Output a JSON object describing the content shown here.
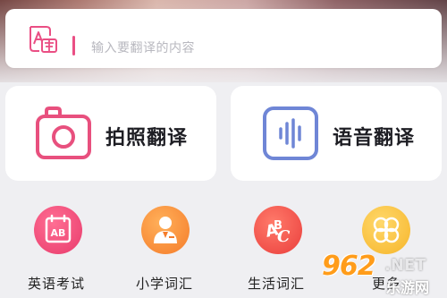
{
  "search": {
    "placeholder": "输入要翻译的内容",
    "icon": "translate-icon"
  },
  "cards": [
    {
      "label": "拍照翻译",
      "icon": "camera-icon",
      "color": "#e8507e"
    },
    {
      "label": "语音翻译",
      "icon": "voice-wave-icon",
      "color": "#6f86d6"
    }
  ],
  "quick_items": [
    {
      "label": "英语考试",
      "icon": "calendar-ab-icon",
      "color": "#e83b6c"
    },
    {
      "label": "小学词汇",
      "icon": "student-icon",
      "color": "#f57c2a"
    },
    {
      "label": "生活词汇",
      "icon": "abc-letters-icon",
      "color": "#ea3e3c"
    },
    {
      "label": "更多",
      "icon": "clover-icon",
      "color": "#f6b52a"
    }
  ],
  "watermark": {
    "main": "962",
    "net": ".NET",
    "sub": "乐游网"
  }
}
